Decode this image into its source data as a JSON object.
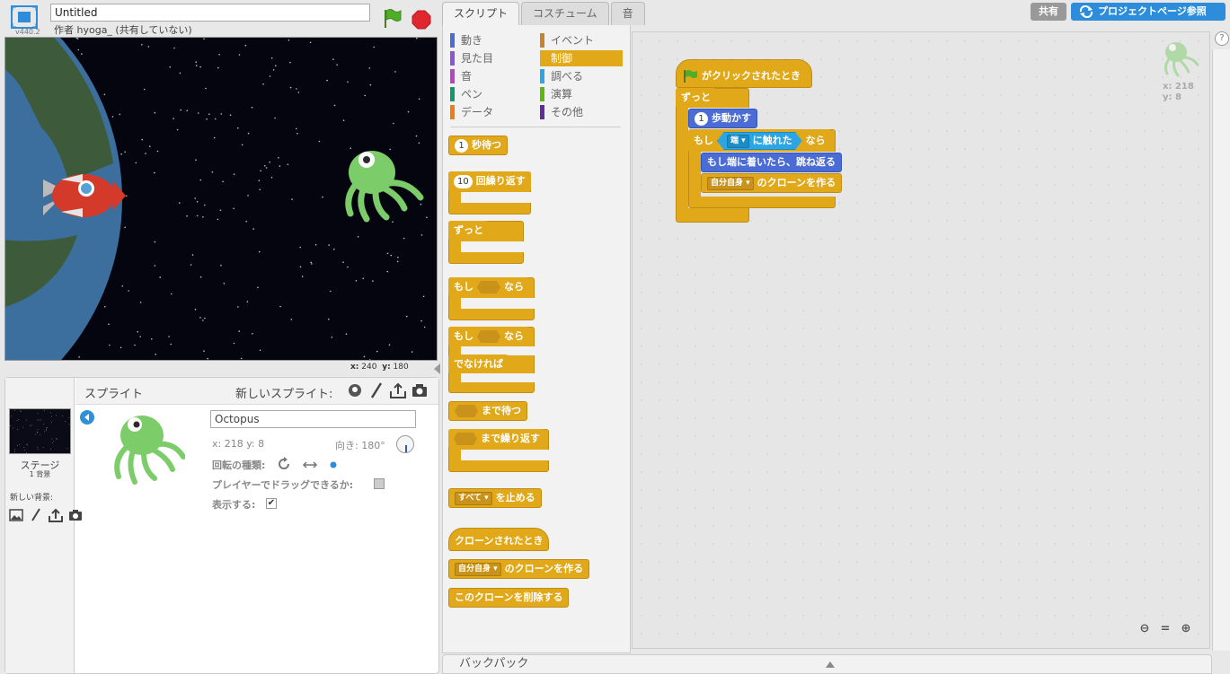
{
  "header": {
    "version": "v440.2",
    "project_title": "Untitled",
    "author": "作者 hyoga_ (共有していない)"
  },
  "stage": {
    "coords_x_label": "x:",
    "coords_x": "240",
    "coords_y_label": "y:",
    "coords_y": "180"
  },
  "sprites_pane": {
    "title": "スプライト",
    "new_sprite_label": "新しいスプライト:",
    "stage_label": "ステージ",
    "bg_count": "1 背景",
    "new_bg_label": "新しい背景:"
  },
  "sprite_info": {
    "name": "Octopus",
    "xy": "x: 218   y: 8",
    "direction": "向き: 180°",
    "rotation_label": "回転の種類:",
    "drag_label": "プレイヤーでドラッグできるか:",
    "show_label": "表示する:",
    "show_checked": "✔"
  },
  "tabs": [
    "スクリプト",
    "コスチューム",
    "音"
  ],
  "top_right": {
    "share": "共有",
    "project_page": "プロジェクトページ参照"
  },
  "categories": [
    {
      "label": "動き",
      "color": "#4a6cd4"
    },
    {
      "label": "イベント",
      "color": "#c88330"
    },
    {
      "label": "見た目",
      "color": "#8a55d7"
    },
    {
      "label": "制御",
      "color": "#e1a91a"
    },
    {
      "label": "音",
      "color": "#bb42c3"
    },
    {
      "label": "調べる",
      "color": "#2ca5e2"
    },
    {
      "label": "ペン",
      "color": "#0e9a6c"
    },
    {
      "label": "演算",
      "color": "#5cb712"
    },
    {
      "label": "データ",
      "color": "#ee7d16"
    },
    {
      "label": "その他",
      "color": "#632d99"
    }
  ],
  "palette_blocks": {
    "wait_num": "1",
    "wait": "秒待つ",
    "repeat_num": "10",
    "repeat": "回繰り返す",
    "forever": "ずっと",
    "if_label": "もし",
    "then_label": "なら",
    "else_label": "でなければ",
    "wait_until": "まで待つ",
    "repeat_until": "まで繰り返す",
    "stop_dropdown": "すべて",
    "stop": "を止める",
    "when_clone": "クローンされたとき",
    "clone_dropdown": "自分自身",
    "create_clone": "のクローンを作る",
    "delete_clone": "このクローンを削除する"
  },
  "script": {
    "hat": "がクリックされたとき",
    "forever": "ずっと",
    "move_num": "1",
    "move": "歩動かす",
    "if_label": "もし",
    "touch_dropdown": "端",
    "touching": "に触れた",
    "then_label": "なら",
    "bounce": "もし端に着いたら、跳ね返る",
    "clone_dropdown": "自分自身",
    "create_clone": "のクローンを作る"
  },
  "script_area": {
    "sprite_x": "x: 218",
    "sprite_y": "y: 8"
  },
  "help": "?",
  "backpack": "バックパック",
  "colors": {
    "control": "#e1a91a",
    "motion": "#4a6cd4",
    "sensing": "#2ca5e2",
    "share_btn": "#999999",
    "project_btn": "#2d8ddb"
  }
}
